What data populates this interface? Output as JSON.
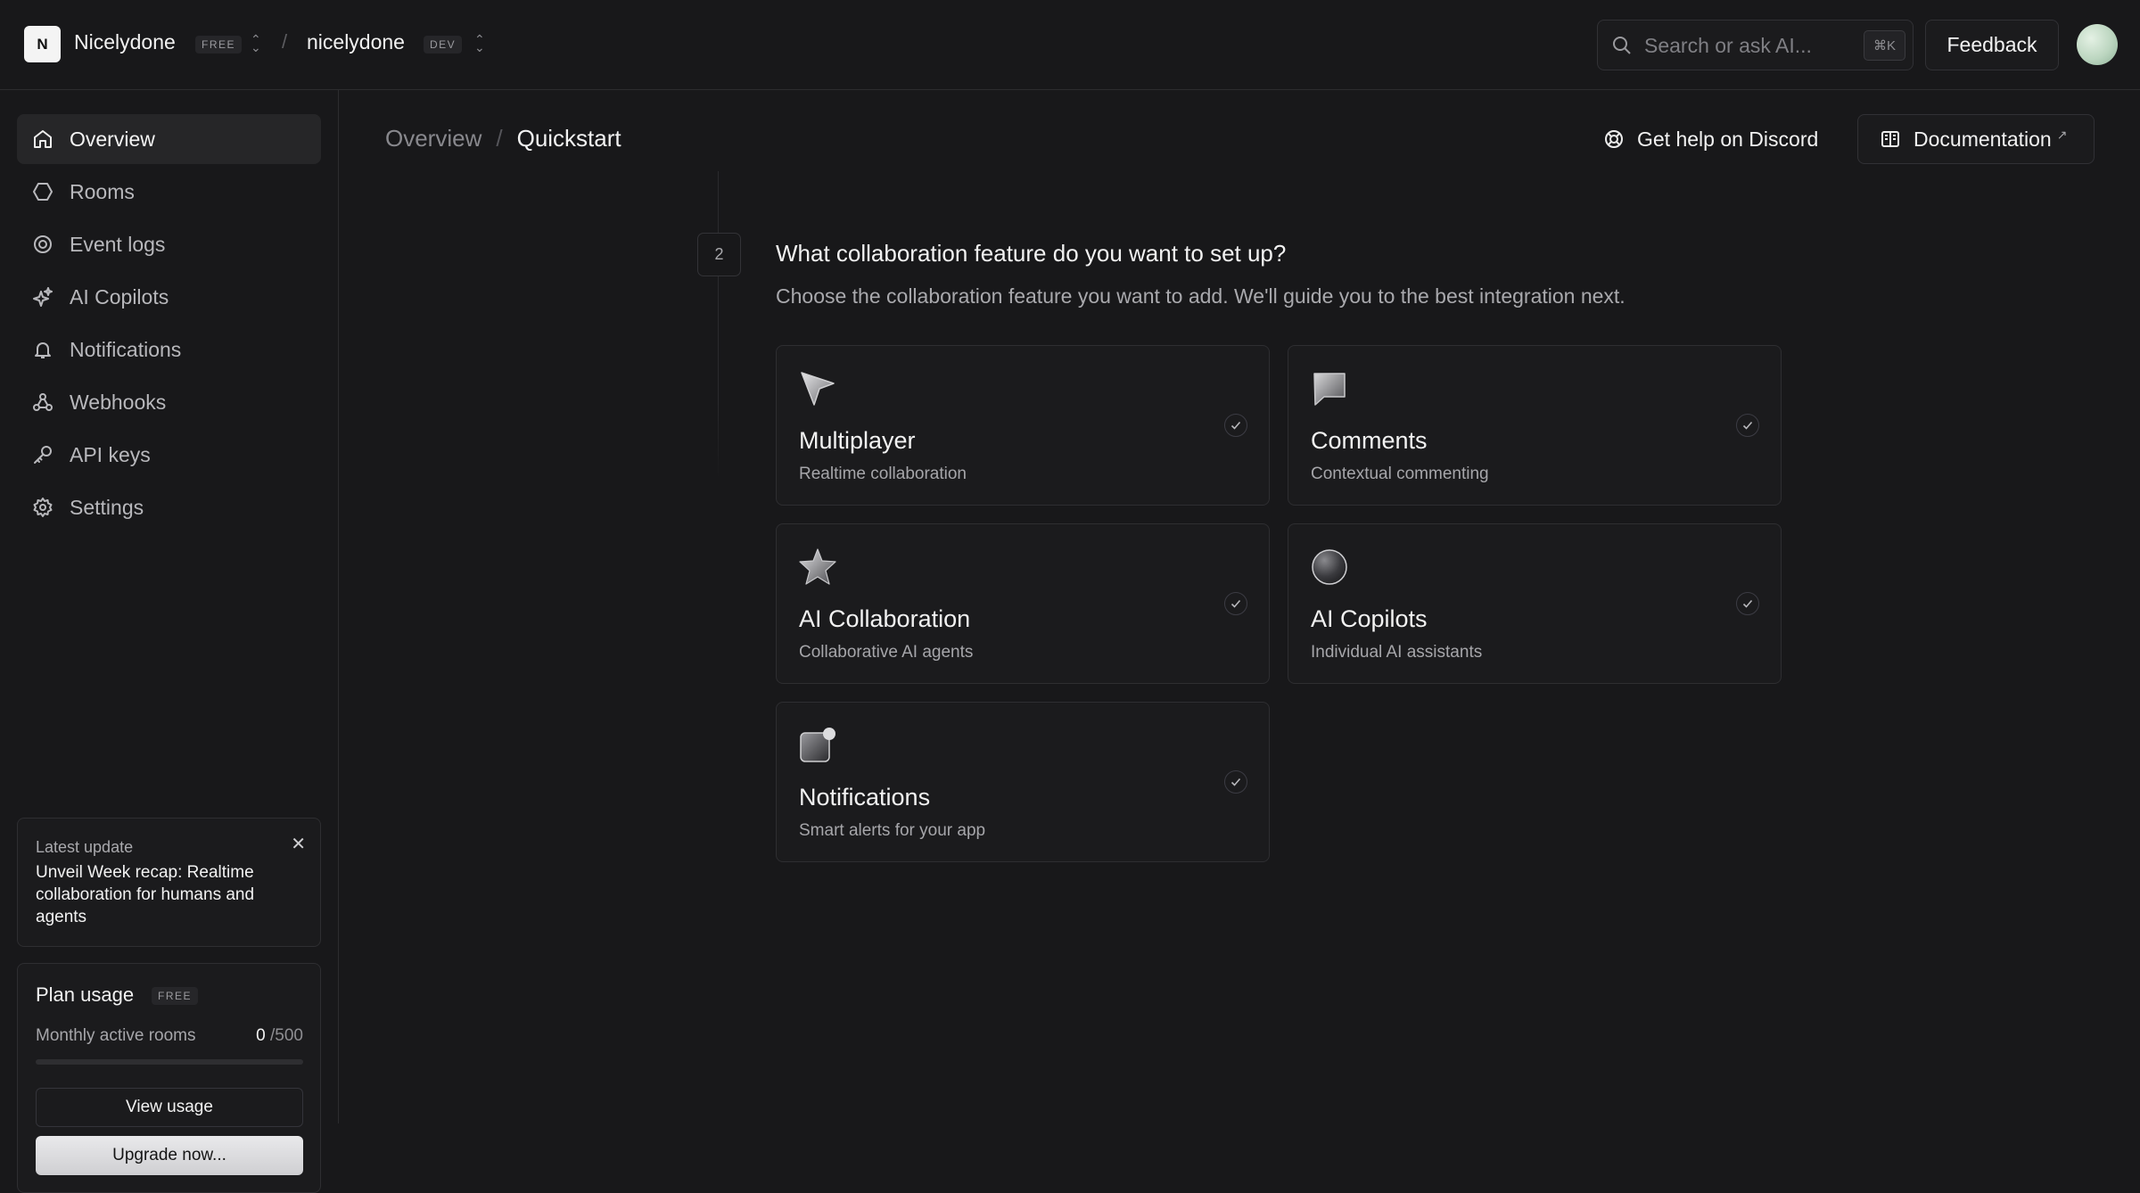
{
  "topbar": {
    "logo_letter": "N",
    "org_name": "Nicelydone",
    "org_plan": "FREE",
    "separator": "/",
    "project_name": "nicelydone",
    "project_env": "DEV",
    "search_placeholder": "Search or ask AI...",
    "search_shortcut": "⌘K",
    "feedback_label": "Feedback"
  },
  "sidebar": {
    "items": [
      {
        "label": "Overview",
        "icon": "home-icon"
      },
      {
        "label": "Rooms",
        "icon": "hexagon-icon"
      },
      {
        "label": "Event logs",
        "icon": "target-icon"
      },
      {
        "label": "AI Copilots",
        "icon": "sparkles-icon"
      },
      {
        "label": "Notifications",
        "icon": "bell-icon"
      },
      {
        "label": "Webhooks",
        "icon": "webhook-icon"
      },
      {
        "label": "API keys",
        "icon": "key-icon"
      },
      {
        "label": "Settings",
        "icon": "gear-icon"
      }
    ],
    "update": {
      "label": "Latest update",
      "text": "Unveil Week recap: Realtime collaboration for humans and agents",
      "close": "✕"
    },
    "plan": {
      "title": "Plan usage",
      "tag": "FREE",
      "metric_label": "Monthly active rooms",
      "used": "0",
      "total": "/500",
      "usage_fraction": 0,
      "view_usage": "View usage",
      "upgrade": "Upgrade now..."
    }
  },
  "header": {
    "breadcrumb_root": "Overview",
    "breadcrumb_sep": "/",
    "breadcrumb_current": "Quickstart",
    "discord_label": "Get help on Discord",
    "docs_label": "Documentation",
    "docs_ext": "↗"
  },
  "step": {
    "number": "2",
    "title": "What collaboration feature do you want to set up?",
    "subtitle": "Choose the collaboration feature you want to add. We'll guide you to the best integration next."
  },
  "features": [
    {
      "title": "Multiplayer",
      "desc": "Realtime collaboration",
      "icon": "cursor-arrow-icon"
    },
    {
      "title": "Comments",
      "desc": "Contextual commenting",
      "icon": "comment-bubble-icon"
    },
    {
      "title": "AI Collaboration",
      "desc": "Collaborative AI agents",
      "icon": "star-icon"
    },
    {
      "title": "AI Copilots",
      "desc": "Individual AI assistants",
      "icon": "orb-icon"
    },
    {
      "title": "Notifications",
      "desc": "Smart alerts for your app",
      "icon": "notification-square-icon"
    }
  ]
}
